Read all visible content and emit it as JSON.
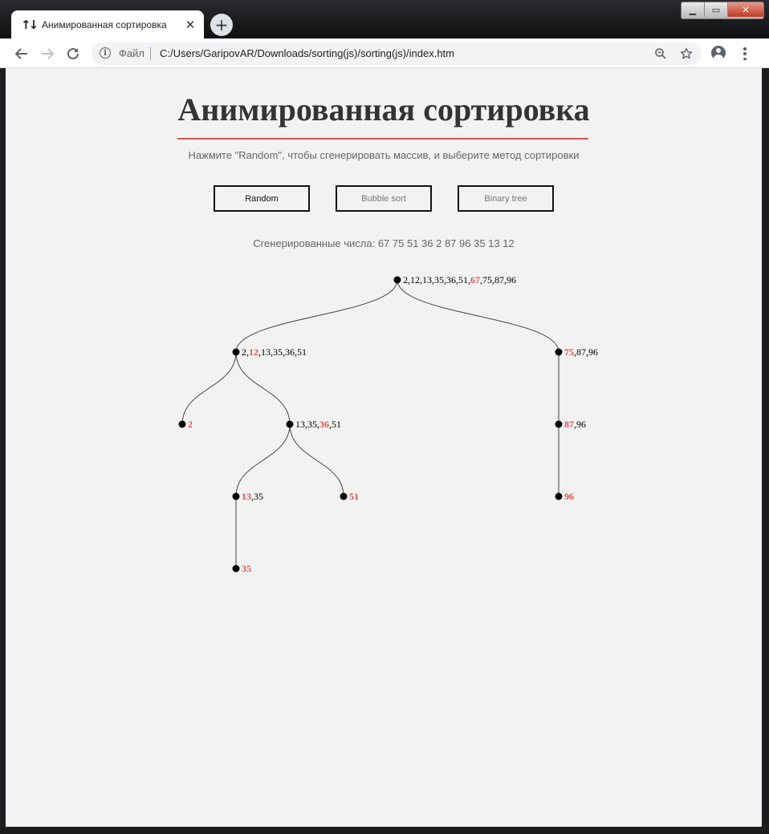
{
  "browser": {
    "tab_title": "Анимированная сортировка",
    "tab_icon": "↑↓",
    "scheme_label": "Файл",
    "url": "C:/Users/GaripovAR/Downloads/sorting(js)/sorting(js)/index.htm"
  },
  "page": {
    "title": "Анимированная сортировка",
    "subtitle": "Нажмите \"Random\", чтобы сгенерировать массив, и выберите метод сортировки",
    "buttons": {
      "random": "Random",
      "bubble": "Bubble sort",
      "tree": "Binary tree"
    },
    "generated_text": "Сгенерированные числа: 67 75 51 36 2 87 96 35 13 12"
  },
  "tree": {
    "nodes": [
      {
        "id": "n1",
        "values": [
          2,
          12,
          13,
          35,
          36,
          51,
          67,
          75,
          87,
          96
        ],
        "highlight": 67
      },
      {
        "id": "n2",
        "values": [
          2,
          12,
          13,
          35,
          36,
          51
        ],
        "highlight": 12
      },
      {
        "id": "n3",
        "values": [
          75,
          87,
          96
        ],
        "highlight": 75
      },
      {
        "id": "n4",
        "values": [
          2
        ],
        "highlight": 2
      },
      {
        "id": "n5",
        "values": [
          13,
          35,
          36,
          51
        ],
        "highlight": 36
      },
      {
        "id": "n6",
        "values": [
          87,
          96
        ],
        "highlight": 87
      },
      {
        "id": "n7",
        "values": [
          13,
          35
        ],
        "highlight": 13
      },
      {
        "id": "n8",
        "values": [
          51
        ],
        "highlight": 51
      },
      {
        "id": "n9",
        "values": [
          96
        ],
        "highlight": 96
      },
      {
        "id": "n10",
        "values": [
          35
        ],
        "highlight": 35
      }
    ],
    "edges": [
      [
        "n1",
        "n2"
      ],
      [
        "n1",
        "n3"
      ],
      [
        "n2",
        "n4"
      ],
      [
        "n2",
        "n5"
      ],
      [
        "n3",
        "n6"
      ],
      [
        "n5",
        "n7"
      ],
      [
        "n5",
        "n8"
      ],
      [
        "n6",
        "n9"
      ],
      [
        "n7",
        "n10"
      ]
    ],
    "highlight_color": "#d9534f"
  }
}
